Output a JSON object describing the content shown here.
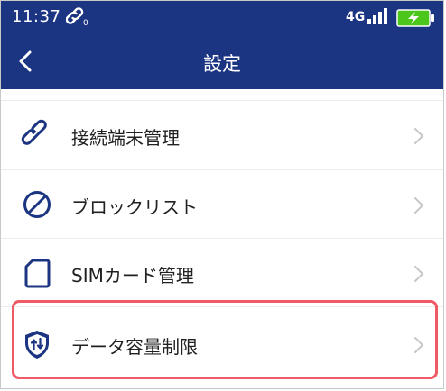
{
  "status_bar": {
    "time": "11:37",
    "network": "4G",
    "link_icon": "link-off-icon",
    "battery_icon": "battery-charging-icon",
    "battery_color": "#4cc61b"
  },
  "app_bar": {
    "title": "設定",
    "back_icon": "chevron-left-icon",
    "background": "#1c3582"
  },
  "settings": {
    "items": [
      {
        "label": "接続端末管理",
        "icon": "link-icon"
      },
      {
        "label": "ブロックリスト",
        "icon": "block-icon"
      },
      {
        "label": "SIMカード管理",
        "icon": "sim-card-icon"
      },
      {
        "label": "データ容量制限",
        "icon": "data-limit-shield-icon"
      }
    ]
  },
  "colors": {
    "accent": "#1c3582",
    "highlight": "#ef5a66",
    "chevron": "#c7c7c7"
  }
}
